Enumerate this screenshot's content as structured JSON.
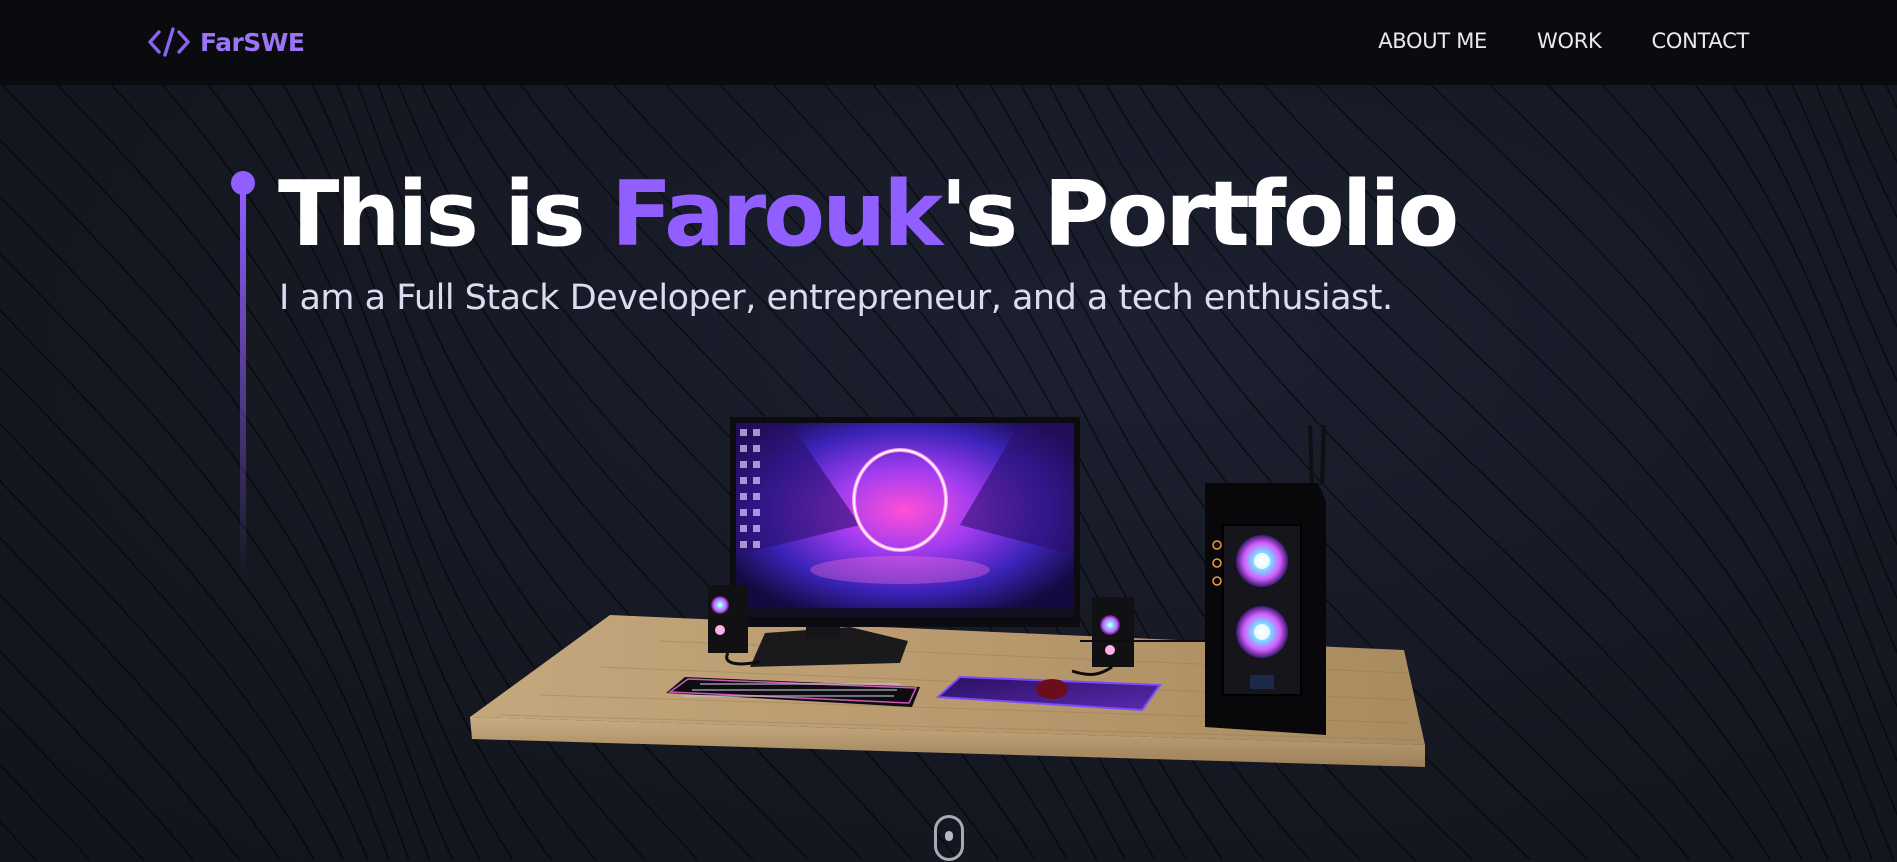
{
  "brand": {
    "logo_text": "FarSWE",
    "icon": "code-brackets-icon",
    "accent": "#915eff"
  },
  "nav": {
    "links": [
      {
        "label": "ABOUT ME"
      },
      {
        "label": "WORK"
      },
      {
        "label": "CONTACT"
      }
    ]
  },
  "hero": {
    "title_prefix": "This is ",
    "title_name": "Farouk",
    "title_suffix": "'s Portfolio",
    "subtitle": "I am a Full Stack Developer, entrepreneur, and a tech enthusiast."
  },
  "scene": {
    "description_icon": "desk-setup-3d"
  },
  "scroll": {
    "icon": "mouse-scroll-icon"
  }
}
